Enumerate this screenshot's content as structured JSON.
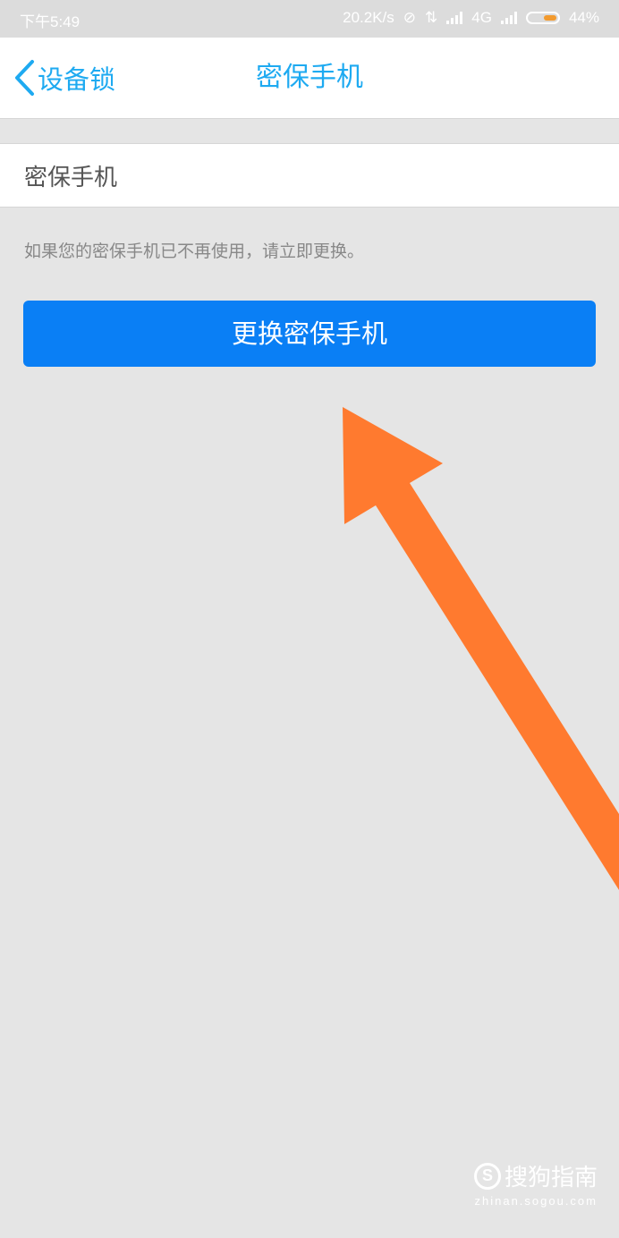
{
  "status_bar": {
    "time": "下午5:49",
    "net_speed": "20.2K/s",
    "network": "4G",
    "battery": "44%",
    "battery_color": "#f29a2e"
  },
  "nav": {
    "back_label": "设备锁",
    "title": "密保手机",
    "accent": "#1eaaf1"
  },
  "field": {
    "label": "密保手机"
  },
  "hint": "如果您的密保手机已不再使用，请立即更换。",
  "primary_button": {
    "label": "更换密保手机",
    "color": "#0a7ff5"
  },
  "annotation": {
    "arrow_color": "#ff7a2f"
  },
  "watermark": {
    "logo": "S",
    "brand": "搜狗指南",
    "url": "zhinan.sogou.com"
  },
  "icons": [
    "chevron-left-icon",
    "alarm-off-icon",
    "data-arrows-icon",
    "signal-icon",
    "battery-icon",
    "arrow-annotation"
  ]
}
